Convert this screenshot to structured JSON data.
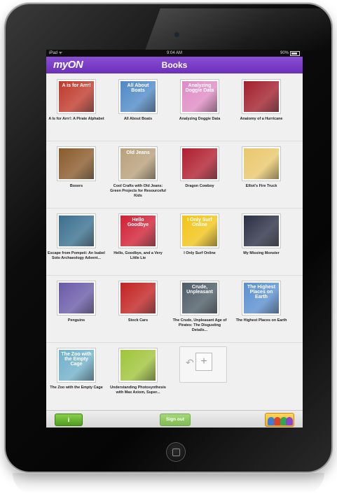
{
  "status": {
    "carrier": "iPad ᯤ",
    "time": "9:04 AM",
    "battery": "90%"
  },
  "app": {
    "logo": "myON",
    "title": "Books"
  },
  "books": [
    {
      "title": "A Is for Arrr!: A Pirate Alphabet",
      "cover_text": "A is for Arrr!",
      "color": "#c0392b"
    },
    {
      "title": "All About Boats",
      "cover_text": "All About Boats",
      "color": "#4f89c7"
    },
    {
      "title": "Analyzing Doggie Data",
      "cover_text": "Analyzing Doggie Data",
      "color": "#e08bc4"
    },
    {
      "title": "Anatomy of a Hurricane",
      "cover_text": "",
      "color": "#a21f2b"
    },
    {
      "title": "Boxers",
      "cover_text": "",
      "color": "#8a5a2b"
    },
    {
      "title": "Cool Crafts with Old Jeans: Green Projects for Resourceful Kids",
      "cover_text": "Old Jeans",
      "color": "#b8a07a"
    },
    {
      "title": "Dragon Cowboy",
      "cover_text": "",
      "color": "#b01e2e"
    },
    {
      "title": "Elliot's Fire Truck",
      "cover_text": "",
      "color": "#e9c76b"
    },
    {
      "title": "Escape from Pompeii: An Isabel Soto Archaeology Advent...",
      "cover_text": "",
      "color": "#3a6f8f"
    },
    {
      "title": "Hello, Goodbye, and a Very Little Lie",
      "cover_text": "Hello Goodbye",
      "color": "#d02035"
    },
    {
      "title": "I Only Surf Online",
      "cover_text": "I Only Surf Online",
      "color": "#f2c418"
    },
    {
      "title": "My Missing Monster",
      "cover_text": "",
      "color": "#2b2f44"
    },
    {
      "title": "Penguins",
      "cover_text": "",
      "color": "#6a5aa8"
    },
    {
      "title": "Stock Cars",
      "cover_text": "",
      "color": "#c22222"
    },
    {
      "title": "The Crude, Unpleasant Age of Pirates: The Disgusting Details...",
      "cover_text": "Crude, Unpleasant",
      "color": "#4d5c66"
    },
    {
      "title": "The Highest Places on Earth",
      "cover_text": "The Highest Places on Earth",
      "color": "#5a8fd0"
    },
    {
      "title": "The Zoo with the Empty Cage",
      "cover_text": "The Zoo with the Empty Cage",
      "color": "#6fb0c9"
    },
    {
      "title": "Understanding Photosynthesis with Max Axiom, Super...",
      "cover_text": "",
      "color": "#9fc43a"
    }
  ],
  "bottom": {
    "info": "i",
    "signout": "Sign out"
  },
  "colors": {
    "accent": "#7a3fc8",
    "button_green": "#6db33f"
  },
  "icons": {
    "add": "add-book-icon",
    "info": "info-icon",
    "avatars": "avatars-icon"
  }
}
